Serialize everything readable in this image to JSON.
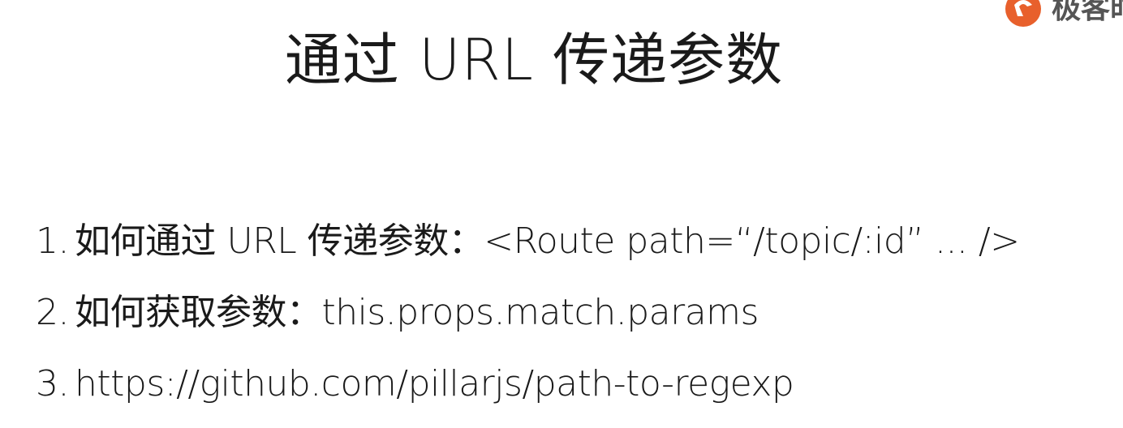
{
  "slide": {
    "title": "通过 URL 传递参数",
    "logo_text": "极客时",
    "items": [
      {
        "number": "1.",
        "text": "如何通过 URL 传递参数：<Route path=“/topic/:id” ... />"
      },
      {
        "number": "2.",
        "text": "如何获取参数：this.props.match.params"
      },
      {
        "number": "3.",
        "text": "https://github.com/pillarjs/path-to-regexp"
      }
    ]
  },
  "colors": {
    "text": "#1a1a1a",
    "logo_orange": "#e8602c",
    "background": "#ffffff"
  },
  "icons": {
    "logo": "geektime-logo-icon"
  }
}
